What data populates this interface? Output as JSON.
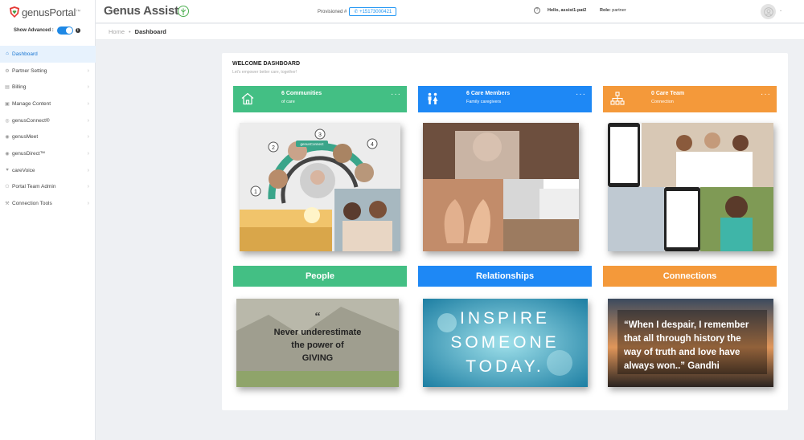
{
  "sidebar": {
    "logo_text": "genusPortal",
    "logo_tm": "™",
    "show_advanced_label": "Show Advanced :",
    "items": [
      {
        "label": "Dashboard",
        "icon": "home-icon",
        "active": true
      },
      {
        "label": "Partner Setting",
        "icon": "gear-icon"
      },
      {
        "label": "Billing",
        "icon": "document-icon"
      },
      {
        "label": "Manage Content",
        "icon": "content-icon"
      },
      {
        "label": "genusConnect®",
        "icon": "connect-icon"
      },
      {
        "label": "genusMeet",
        "icon": "meet-icon"
      },
      {
        "label": "genusDirect™",
        "icon": "direct-icon"
      },
      {
        "label": "careVoice",
        "icon": "voice-icon"
      },
      {
        "label": "Portal Team Admin",
        "icon": "team-icon"
      },
      {
        "label": "Connection Tools",
        "icon": "tools-icon"
      }
    ]
  },
  "header": {
    "title": "Genus Assist",
    "provisioned_label": "Provisioned #",
    "phone": "+15173000421",
    "hello": "Hello, assist1-pat2",
    "role_label": "Role:",
    "role_value": "partner"
  },
  "breadcrumb": {
    "home": "Home",
    "current": "Dashboard"
  },
  "dashboard": {
    "title": "WELCOME DASHBOARD",
    "subtitle": "Let's empower better care, together!",
    "stats": [
      {
        "value": "6 Communities",
        "label": "of care",
        "icon": "home-outline-icon",
        "color": "#43bf84"
      },
      {
        "value": "6 Care Members",
        "label": "Family caregivers",
        "icon": "people-icon",
        "color": "#1e88f5"
      },
      {
        "value": "0 Care Team",
        "label": "Connection",
        "icon": "org-chart-icon",
        "color": "#f4993a"
      }
    ],
    "categories": [
      "People",
      "Relationships",
      "Connections"
    ],
    "photo_labels": {
      "steps": [
        "1",
        "2",
        "3",
        "4"
      ],
      "center": "genusConnect"
    },
    "quotes": {
      "q1_mark": "“",
      "q1_line1": "Never underestimate",
      "q1_line2": "the power of",
      "q1_line3": "GIVING",
      "q2_line1": "INSPIRE",
      "q2_line2": "SOMEONE",
      "q2_line3": "TODAY.",
      "q3_line1": "“When I despair, I remember",
      "q3_line2": "that all through history the",
      "q3_line3": "way of truth and love have",
      "q3_line4": "always won..”  Gandhi"
    }
  },
  "colors": {
    "accent": "#1e88e5",
    "green": "#43bf84",
    "blue": "#1e88f5",
    "orange": "#f4993a"
  }
}
